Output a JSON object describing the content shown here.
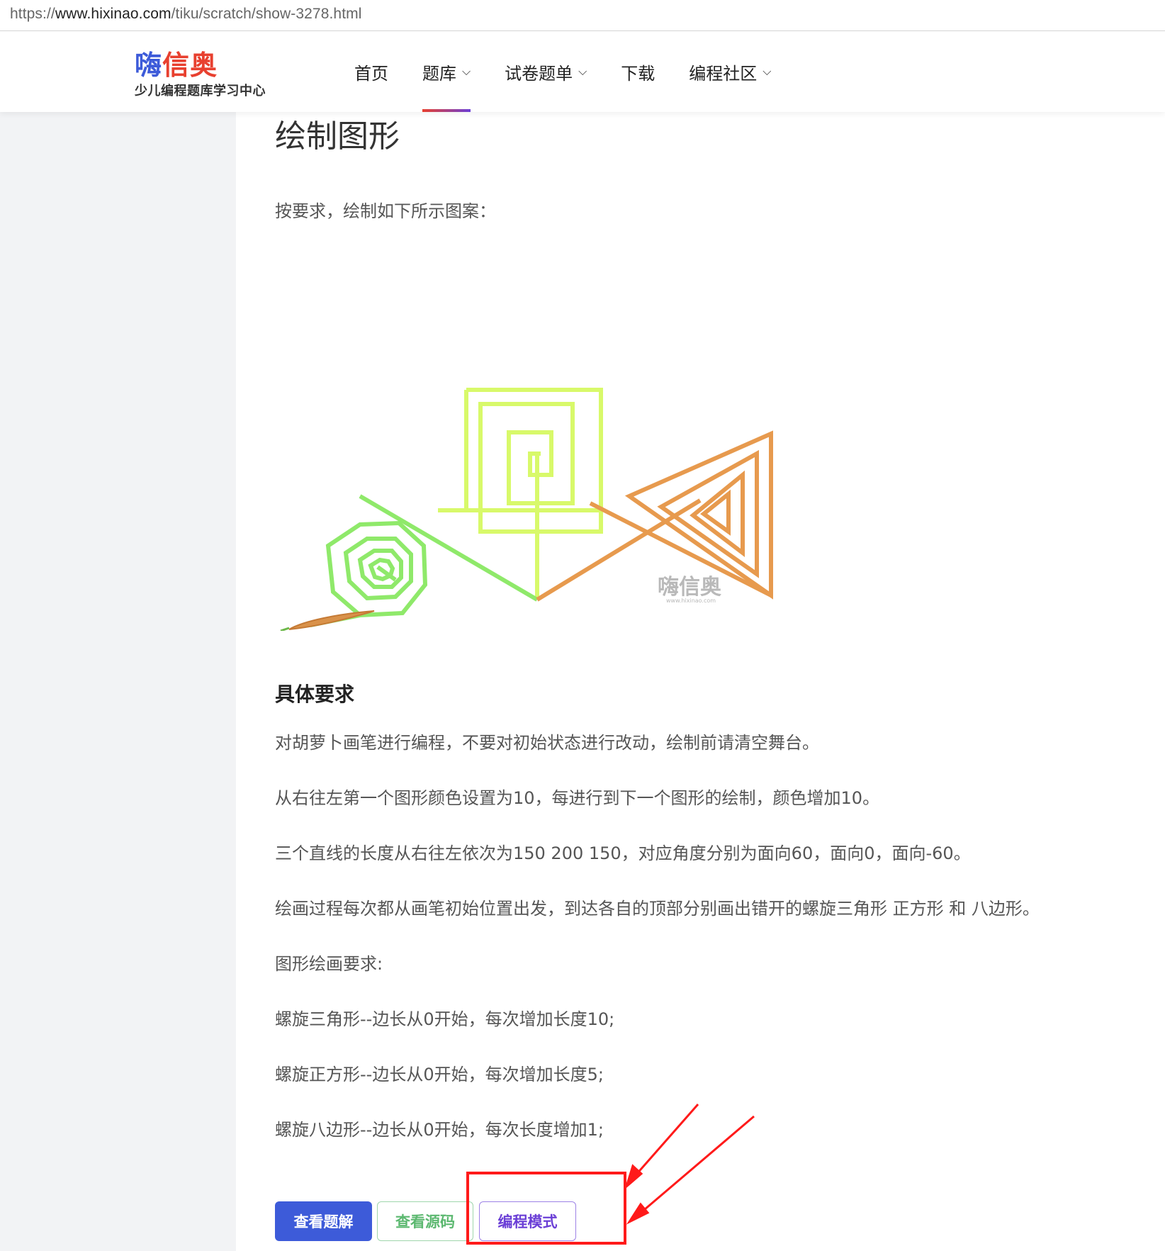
{
  "browser": {
    "url_prefix": "https://",
    "url_host": "www.hixinao.com",
    "url_path": "/tiku/scratch/show-3278.html"
  },
  "header": {
    "logo_part1": "嗨",
    "logo_part2": "信奥",
    "slogan": "少儿编程题库学习中心",
    "nav": [
      {
        "label": "首页"
      },
      {
        "label": "题库"
      },
      {
        "label": "试卷题单"
      },
      {
        "label": "下载"
      },
      {
        "label": "编程社区"
      }
    ]
  },
  "content": {
    "title": "绘制图形",
    "intro": "按要求，绘制如下所示图案：",
    "watermark_brand": "嗨信奥",
    "watermark_url": "www.hixinao.com",
    "subhead": "具体要求",
    "paragraphs": [
      "对胡萝卜画笔进行编程，不要对初始状态进行改动，绘制前请清空舞台。",
      "从右往左第一个图形颜色设置为10，每进行到下一个图形的绘制，颜色增加10。",
      "三个直线的长度从右往左依次为150 200 150，对应角度分别为面向60，面向0，面向-60。",
      "绘画过程每次都从画笔初始位置出发，到达各自的顶部分别画出错开的螺旋三角形 正方形 和 八边形。",
      "图形绘画要求:",
      "螺旋三角形--边长从0开始，每次增加长度10;",
      "螺旋正方形--边长从0开始，每次增加长度5;",
      "螺旋八边形--边长从0开始，每次长度增加1;"
    ],
    "buttons": {
      "view_solution": "查看题解",
      "view_source": "查看源码",
      "code_mode": "编程模式"
    }
  },
  "colors": {
    "brand_blue": "#3d5bd9",
    "brand_red": "#e8402f",
    "accent_purple": "#6b3fd6",
    "triangle_orange": "#e79a4e",
    "square_yellowgreen": "#d8f96a",
    "octagon_green": "#8fe96a",
    "annotation_red": "#ff1a1a"
  }
}
